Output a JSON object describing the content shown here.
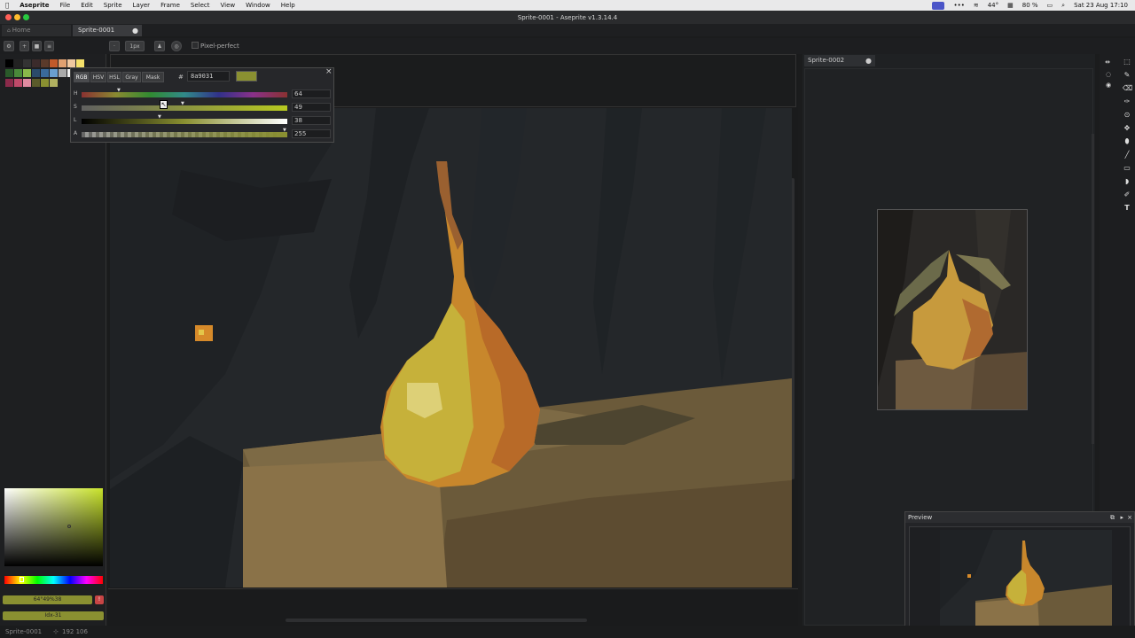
{
  "menubar": {
    "app": "Aseprite",
    "items": [
      "File",
      "Edit",
      "Sprite",
      "Layer",
      "Frame",
      "Select",
      "View",
      "Window",
      "Help"
    ],
    "battery": "80 %",
    "temperature": "44°",
    "clock": "Sat 23 Aug  17:10"
  },
  "window": {
    "title": "Sprite-0001 - Aseprite v1.3.14.4"
  },
  "tabs": [
    {
      "label": "Home"
    },
    {
      "label": "Sprite-0001"
    }
  ],
  "toolbar": {
    "brush_size": "1px",
    "pixel_perfect": "Pixel-perfect"
  },
  "color_popup": {
    "modes": [
      "RGB",
      "HSV",
      "HSL",
      "Gray",
      "Mask"
    ],
    "hex_symbol": "#",
    "hex": "8a9031",
    "swatch": "#8a9031",
    "sliders": [
      {
        "label": "H",
        "value": "64"
      },
      {
        "label": "S",
        "value": "49"
      },
      {
        "label": "L",
        "value": "38"
      },
      {
        "label": "A",
        "value": "255"
      }
    ]
  },
  "left_panel": {
    "fg_label": "64°49%38",
    "bg_label": "Idx-31"
  },
  "right_panel": {
    "tab": "Sprite-0002"
  },
  "preview": {
    "title": "Preview"
  },
  "statusbar": {
    "sprite": "Sprite-0001",
    "coords": "192 106"
  },
  "colors": {
    "accent": "#4b55c8",
    "selected_swatch": "#8a9031"
  }
}
